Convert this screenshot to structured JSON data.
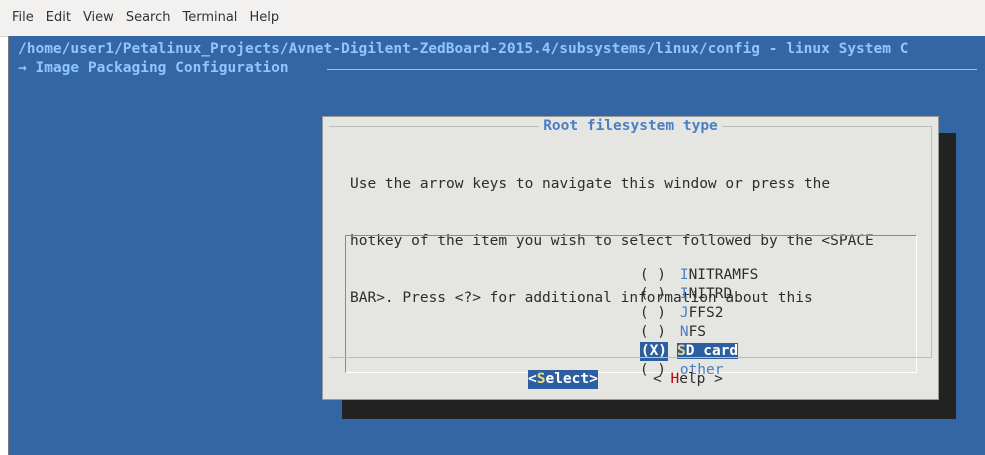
{
  "menubar": {
    "items": [
      "File",
      "Edit",
      "View",
      "Search",
      "Terminal",
      "Help"
    ]
  },
  "terminal": {
    "path_line": "/home/user1/Petalinux_Projects/Avnet-Digilent-ZedBoard-2015.4/subsystems/linux/config - linux System C",
    "breadcrumb": "→ Image Packaging Configuration"
  },
  "dialog": {
    "title": "Root filesystem type",
    "help_lines": [
      "Use the arrow keys to navigate this window or press the",
      "hotkey of the item you wish to select followed by the <SPACE",
      "BAR>. Press <?> for additional information about this"
    ],
    "options": [
      {
        "mark": "( )",
        "hotkey": "I",
        "rest": "NITRAMFS",
        "selected": false
      },
      {
        "mark": "( )",
        "hotkey": "I",
        "rest": "NITRD",
        "selected": false
      },
      {
        "mark": "( )",
        "hotkey": "J",
        "rest": "FFS2",
        "selected": false
      },
      {
        "mark": "( )",
        "hotkey": "N",
        "rest": "FS",
        "selected": false
      },
      {
        "mark": "(X)",
        "hotkey": "S",
        "rest": "D card",
        "selected": true
      },
      {
        "mark": "( )",
        "hotkey": "o",
        "rest": "ther",
        "selected": false
      }
    ],
    "buttons": {
      "select": {
        "open": "<",
        "hotkey": "S",
        "rest": "elect>"
      },
      "help": {
        "open": "< ",
        "hotkey": "H",
        "rest": "elp >"
      }
    }
  },
  "colors": {
    "terminal_bg": "#3465a4",
    "dialog_bg": "#e5e5e1",
    "highlight": "#2d5fa0",
    "hotkey": "#4a7fc5"
  }
}
